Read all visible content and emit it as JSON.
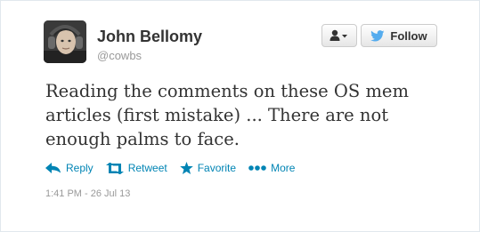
{
  "user": {
    "name": "John Bellomy",
    "handle": "@cowbs"
  },
  "buttons": {
    "follow_label": "Follow",
    "user_menu_icon": "person-dropdown-icon"
  },
  "tweet": {
    "text": "Reading the comments on these OS mem articles (first mistake) ... There are not enough palms to face.",
    "timestamp": "1:41 PM - 26 Jul 13"
  },
  "actions": {
    "reply": "Reply",
    "retweet": "Retweet",
    "favorite": "Favorite",
    "more": "More"
  },
  "colors": {
    "link": "#0084b4",
    "text": "#333333",
    "muted": "#999999",
    "twitter_blue": "#55acee"
  }
}
